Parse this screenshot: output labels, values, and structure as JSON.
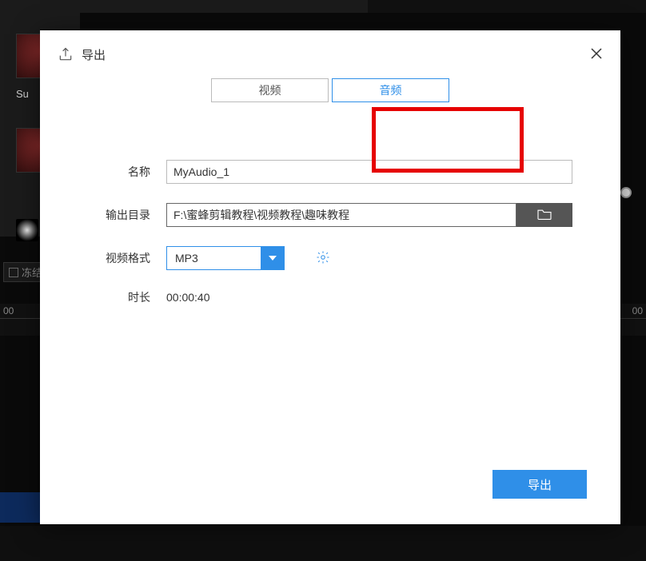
{
  "bg": {
    "thumb_label1": "Su",
    "ruler_left": "00",
    "ruler_right": "00",
    "freeze_label": "冻结"
  },
  "modal": {
    "title": "导出",
    "tabs": {
      "video": "视频",
      "audio": "音频"
    },
    "form": {
      "name_label": "名称",
      "name_value": "MyAudio_1",
      "path_label": "输出目录",
      "path_value": "F:\\蜜蜂剪辑教程\\视频教程\\趣味教程",
      "format_label": "视频格式",
      "format_value": "MP3",
      "duration_label": "时长",
      "duration_value": "00:00:40"
    },
    "export_button": "导出"
  }
}
